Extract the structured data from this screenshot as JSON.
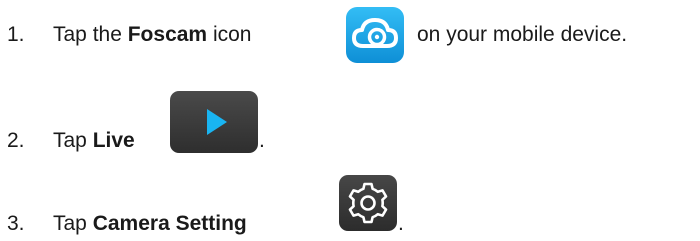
{
  "steps": [
    {
      "number": "1.",
      "prefix": "Tap the ",
      "bold": "Foscam",
      "suffix": " icon",
      "after_icon": "on your mobile device.",
      "icon": "foscam-cloud-icon"
    },
    {
      "number": "2.",
      "prefix": "Tap ",
      "bold": "Live",
      "after_icon": ".",
      "icon": "play-icon"
    },
    {
      "number": "3.",
      "prefix": "Tap ",
      "bold": "Camera Setting",
      "after_icon": ".",
      "icon": "gear-icon"
    }
  ],
  "colors": {
    "foscam_icon_bg": "#1aa3e8",
    "live_icon_bg": "#3d3d3d",
    "live_play": "#19b5f2",
    "gear_icon_bg": "#3a3a3a",
    "text": "#1a1a1a"
  }
}
